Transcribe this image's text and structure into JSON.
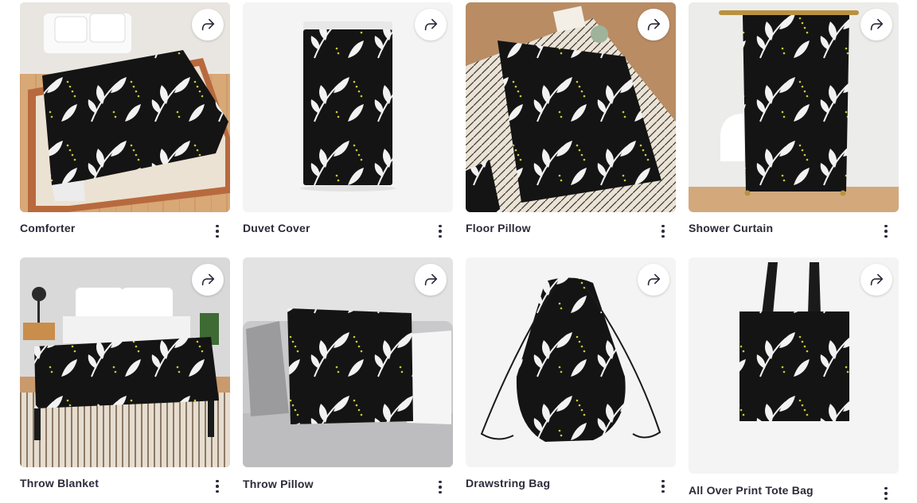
{
  "products": [
    {
      "name": "Comforter",
      "share_icon": "share-arrow-icon",
      "menu_icon": "more-vertical-icon"
    },
    {
      "name": "Duvet Cover",
      "share_icon": "share-arrow-icon",
      "menu_icon": "more-vertical-icon"
    },
    {
      "name": "Floor Pillow",
      "share_icon": "share-arrow-icon",
      "menu_icon": "more-vertical-icon"
    },
    {
      "name": "Shower Curtain",
      "share_icon": "share-arrow-icon",
      "menu_icon": "more-vertical-icon"
    },
    {
      "name": "Throw Blanket",
      "share_icon": "share-arrow-icon",
      "menu_icon": "more-vertical-icon"
    },
    {
      "name": "Throw Pillow",
      "share_icon": "share-arrow-icon",
      "menu_icon": "more-vertical-icon"
    },
    {
      "name": "Drawstring Bag",
      "share_icon": "share-arrow-icon",
      "menu_icon": "more-vertical-icon"
    },
    {
      "name": "All Over Print Tote Bag",
      "share_icon": "share-arrow-icon",
      "menu_icon": "more-vertical-icon"
    }
  ],
  "colors": {
    "pattern_bg": "#141414",
    "leaf": "#f2f2f2",
    "dots": "#c9c93a",
    "label": "#2b2b3a"
  }
}
